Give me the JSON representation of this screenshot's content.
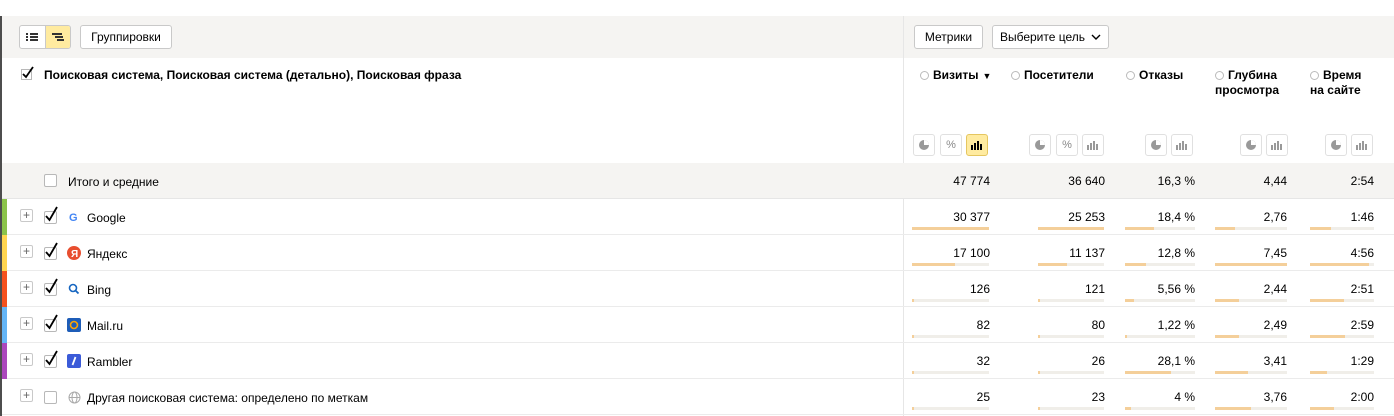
{
  "toolbar": {
    "groupings_label": "Группировки",
    "metrics_label": "Метрики",
    "goal_label": "Выберите цель"
  },
  "header": {
    "dimensions_title": "Поисковая система, Поисковая система (детально), Поисковая фраза",
    "metrics": [
      {
        "line1": "Визиты",
        "line2": "",
        "sorted": true
      },
      {
        "line1": "Посетители",
        "line2": ""
      },
      {
        "line1": "Отказы",
        "line2": ""
      },
      {
        "line1": "Глубина",
        "line2": "просмотра"
      },
      {
        "line1": "Время",
        "line2": "на сайте"
      }
    ],
    "sort_indicator": "▼",
    "percent_symbol": "%"
  },
  "totals": {
    "label": "Итого и средние",
    "values": [
      "47 774",
      "36 640",
      "16,3 %",
      "4,44",
      "2:54"
    ]
  },
  "rows": [
    {
      "label": "Google",
      "icon": "google-icon",
      "color": "#8bc34a",
      "checked": true,
      "values": [
        "30 377",
        "25 253",
        "18,4 %",
        "2,76",
        "1:46"
      ],
      "fills": [
        1.0,
        1.0,
        0.42,
        0.28,
        0.33
      ]
    },
    {
      "label": "Яндекс",
      "icon": "yandex-icon",
      "color": "#ffd54f",
      "checked": true,
      "values": [
        "17 100",
        "11 137",
        "12,8 %",
        "7,45",
        "4:56"
      ],
      "fills": [
        0.56,
        0.44,
        0.3,
        1.0,
        0.92
      ]
    },
    {
      "label": "Bing",
      "icon": "bing-icon",
      "color": "#f4511e",
      "checked": true,
      "values": [
        "126",
        "121",
        "5,56 %",
        "2,44",
        "2:51"
      ],
      "fills": [
        0.01,
        0.01,
        0.13,
        0.33,
        0.53
      ]
    },
    {
      "label": "Mail.ru",
      "icon": "mailru-icon",
      "color": "#64b5f6",
      "checked": true,
      "values": [
        "82",
        "80",
        "1,22 %",
        "2,49",
        "2:59"
      ],
      "fills": [
        0.01,
        0.01,
        0.03,
        0.33,
        0.55
      ]
    },
    {
      "label": "Rambler",
      "icon": "rambler-icon",
      "color": "#ab47bc",
      "checked": true,
      "values": [
        "32",
        "26",
        "28,1 %",
        "3,41",
        "1:29"
      ],
      "fills": [
        0.01,
        0.01,
        0.65,
        0.46,
        0.27
      ]
    },
    {
      "label": "Другая поисковая система: определено по меткам",
      "icon": "globe-icon",
      "color": "",
      "checked": false,
      "values": [
        "25",
        "23",
        "4 %",
        "3,76",
        "2:00"
      ],
      "fills": [
        0.01,
        0.01,
        0.09,
        0.5,
        0.37
      ]
    }
  ]
}
